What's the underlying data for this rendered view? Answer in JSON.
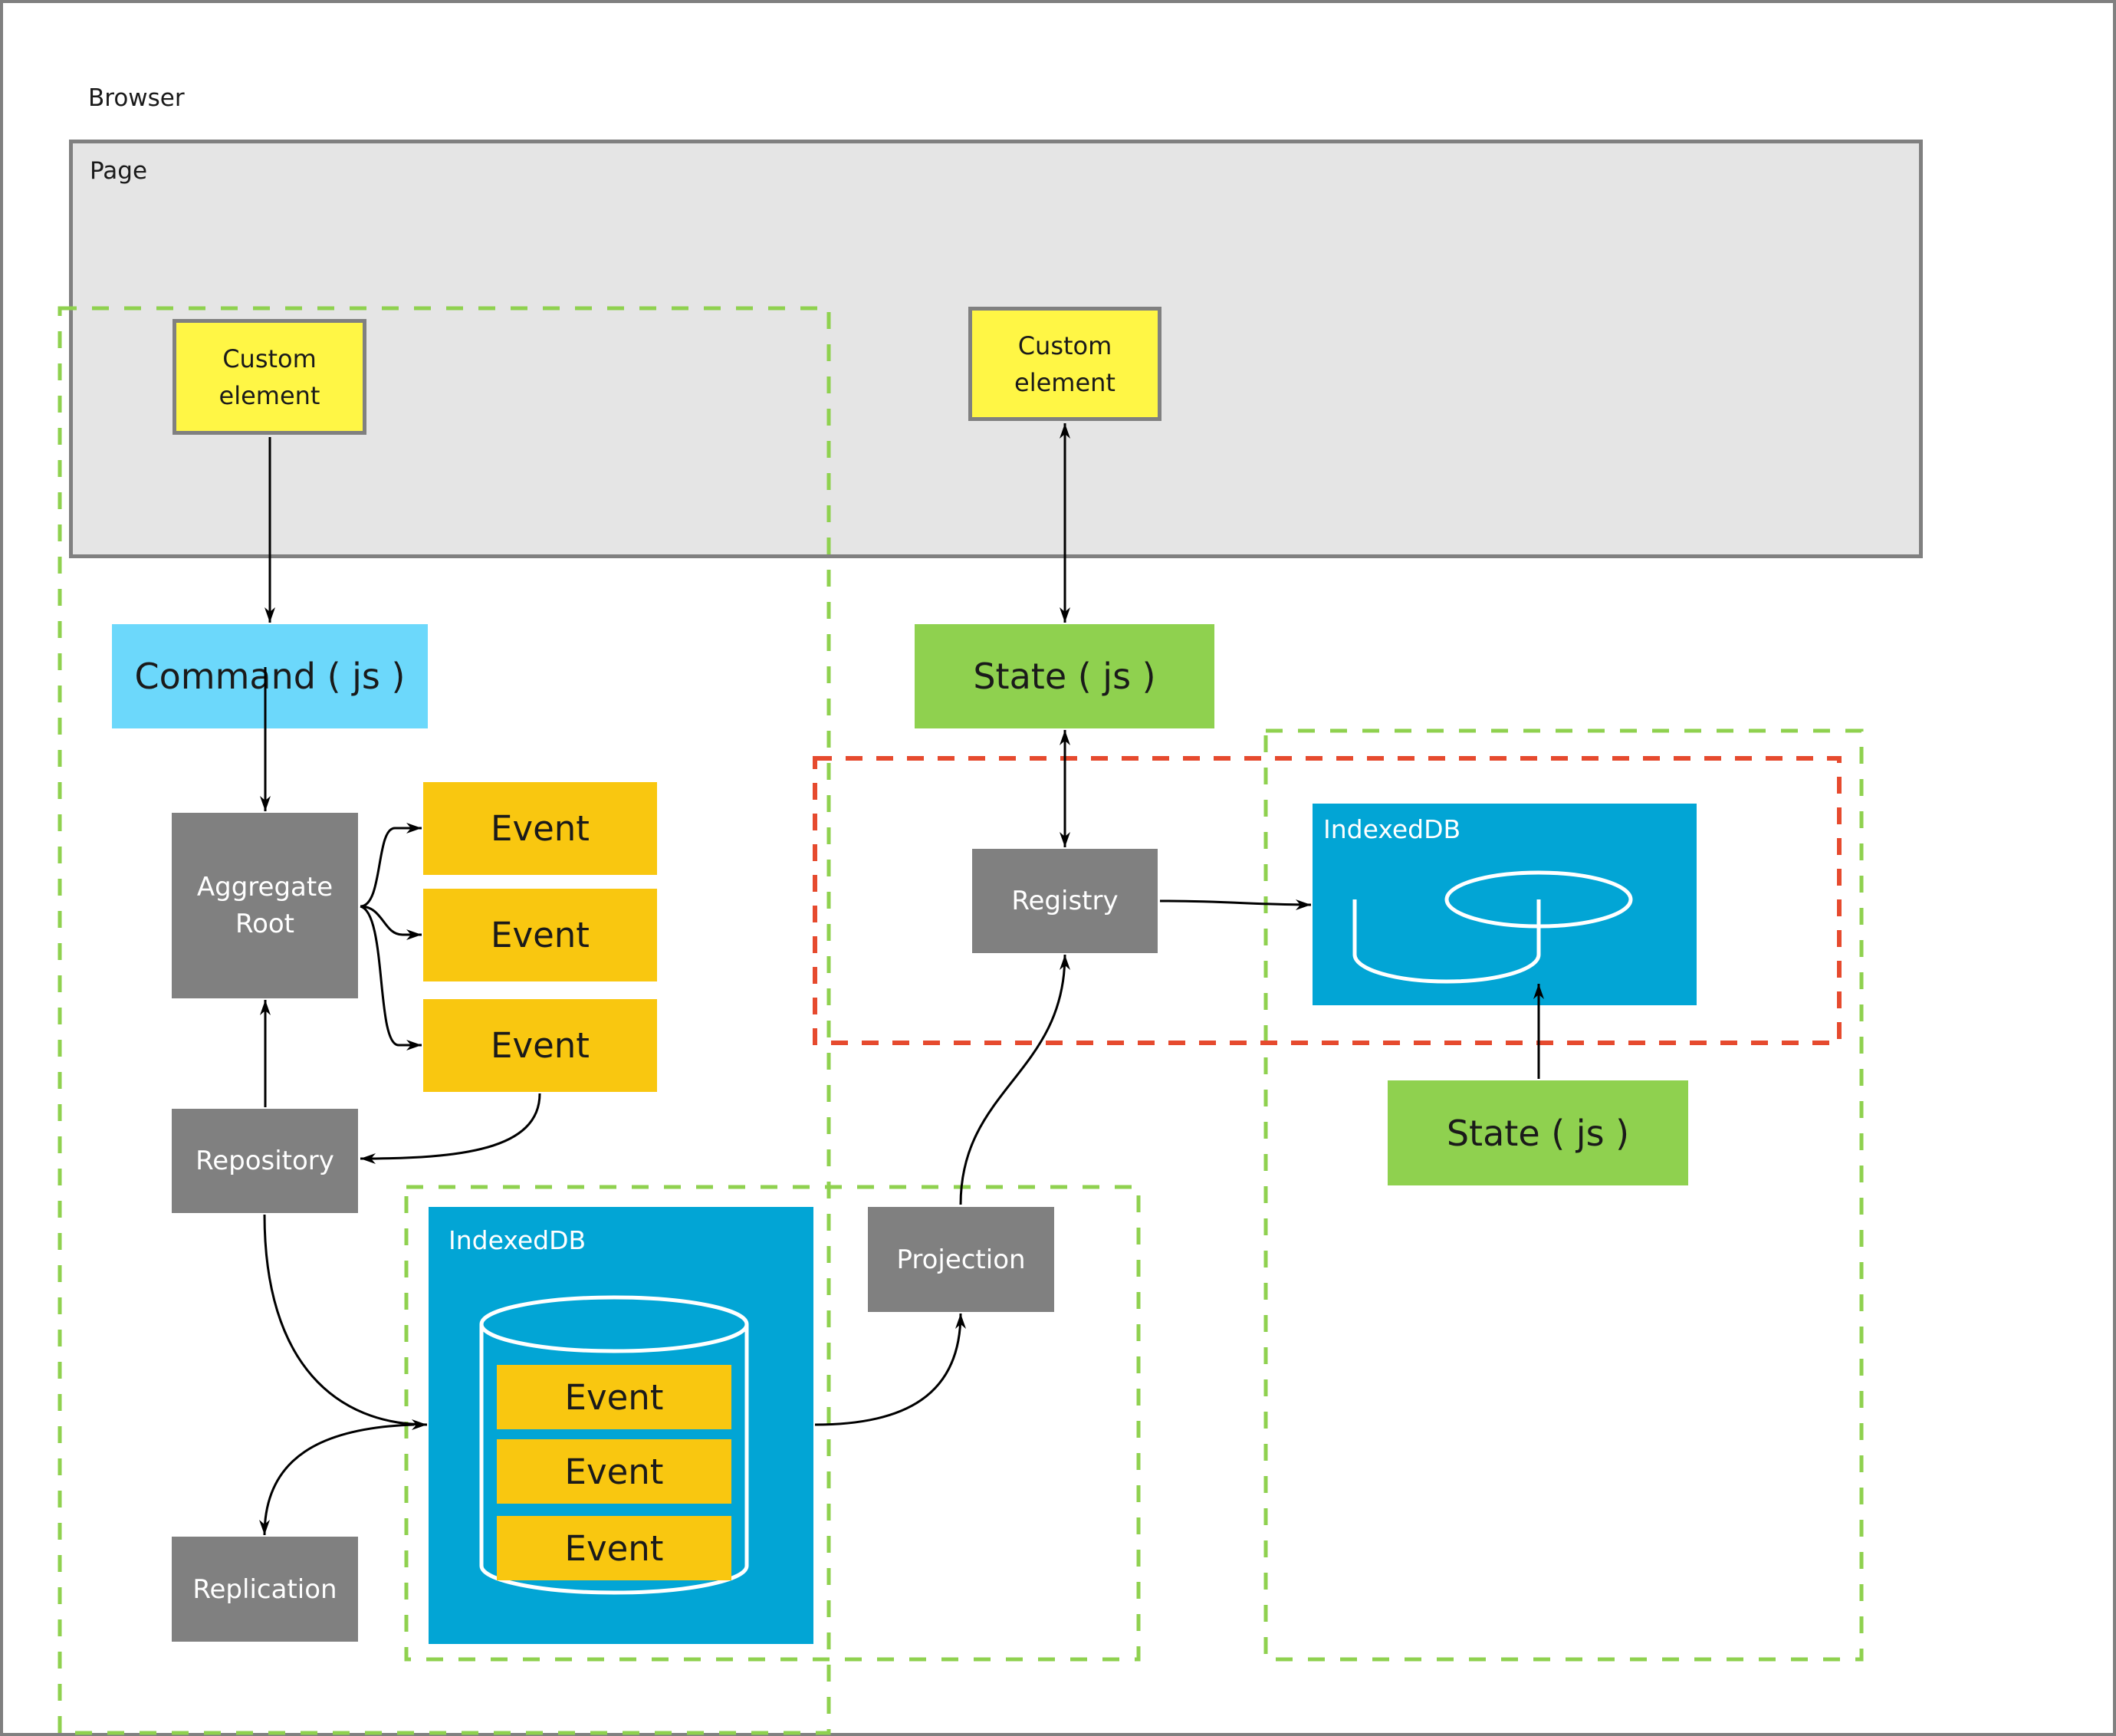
{
  "diagram": {
    "browser": {
      "label": "Browser"
    },
    "page": {
      "label": "Page"
    },
    "command_side": {
      "custom_element": {
        "line1": "Custom",
        "line2": "element"
      },
      "command": {
        "label": "Command ( js )"
      },
      "aggregate_root": {
        "line1": "Aggregate",
        "line2": "Root"
      },
      "events": [
        {
          "label": "Event"
        },
        {
          "label": "Event"
        },
        {
          "label": "Event"
        }
      ],
      "repository": {
        "label": "Repository"
      },
      "replication": {
        "label": "Replication"
      },
      "event_store": {
        "label": "IndexedDB",
        "stored_events": [
          {
            "label": "Event"
          },
          {
            "label": "Event"
          },
          {
            "label": "Event"
          }
        ]
      }
    },
    "query_side": {
      "custom_element": {
        "line1": "Custom",
        "line2": "element"
      },
      "state": {
        "label": "State ( js )"
      },
      "registry": {
        "label": "Registry"
      },
      "projection": {
        "label": "Projection"
      },
      "state_store": {
        "label": "IndexedDB"
      },
      "state_secondary": {
        "label": "State ( js )"
      }
    },
    "colors": {
      "boundary_green": "#8fd14f",
      "boundary_red": "#e64a2e",
      "custom_element": "#fff645",
      "command": "#6cd8fb",
      "state": "#8fd14f",
      "service": "#808080",
      "event": "#f9c710",
      "indexeddb": "#02a5d5",
      "page": "#e5e5e5"
    }
  }
}
